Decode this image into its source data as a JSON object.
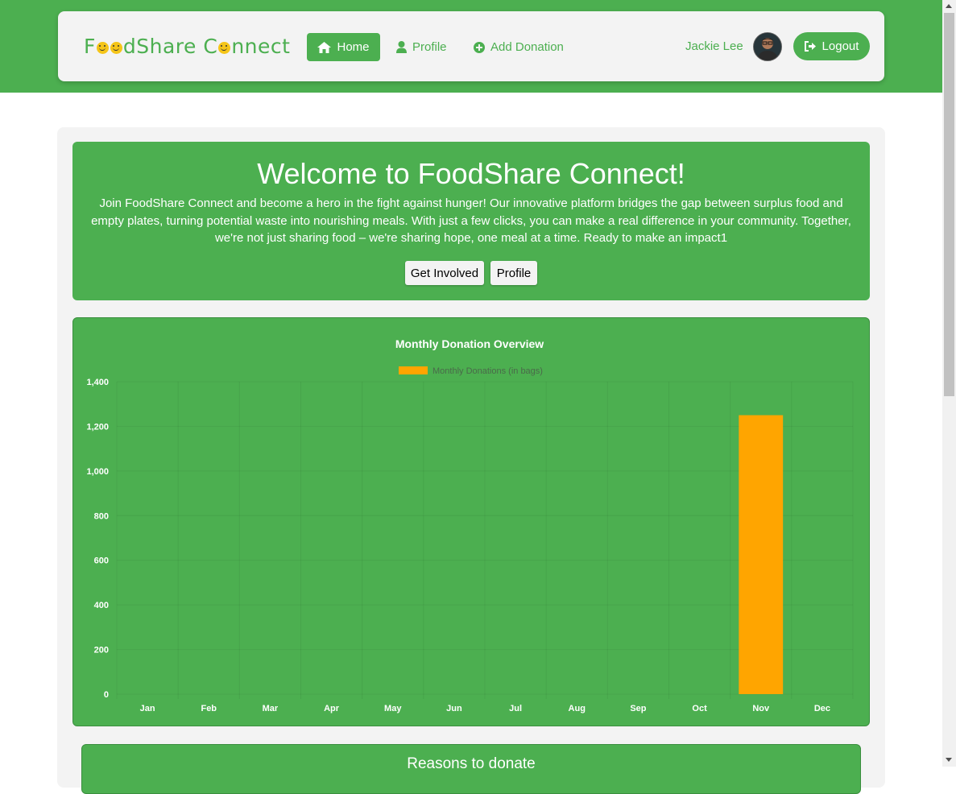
{
  "navbar": {
    "logo_text": "FoodShare Connect",
    "home_label": "Home",
    "profile_label": "Profile",
    "add_donation_label": "Add Donation",
    "user_name": "Jackie Lee",
    "logout_label": "Logout"
  },
  "hero": {
    "title": "Welcome to FoodShare Connect!",
    "body": "Join FoodShare Connect and become a hero in the fight against hunger! Our innovative platform bridges the gap between surplus food and empty plates, turning potential waste into nourishing meals. With just a few clicks, you can make a real difference in your community. Together, we're not just sharing food – we're sharing hope, one meal at a time. Ready to make an impact1",
    "get_involved_label": "Get Involved",
    "profile_label": "Profile"
  },
  "chart_data": {
    "type": "bar",
    "title": "Monthly Donation Overview",
    "categories": [
      "Jan",
      "Feb",
      "Mar",
      "Apr",
      "May",
      "Jun",
      "Jul",
      "Aug",
      "Sep",
      "Oct",
      "Nov",
      "Dec"
    ],
    "series": [
      {
        "name": "Monthly Donations (in bags)",
        "values": [
          0,
          0,
          0,
          0,
          0,
          0,
          0,
          0,
          0,
          0,
          1250,
          0
        ],
        "color": "#ffa500"
      }
    ],
    "ylim": [
      0,
      1400
    ],
    "yticks": [
      0,
      200,
      400,
      600,
      800,
      1000,
      1200,
      1400
    ],
    "ytick_labels": [
      "0",
      "200",
      "400",
      "600",
      "800",
      "1,000",
      "1,200",
      "1,400"
    ],
    "grid": true,
    "legend": "top-center"
  },
  "reasons": {
    "title": "Reasons to donate"
  },
  "colors": {
    "brand": "#4caf50",
    "bar": "#ffa500",
    "panel": "#f3f3f3"
  }
}
